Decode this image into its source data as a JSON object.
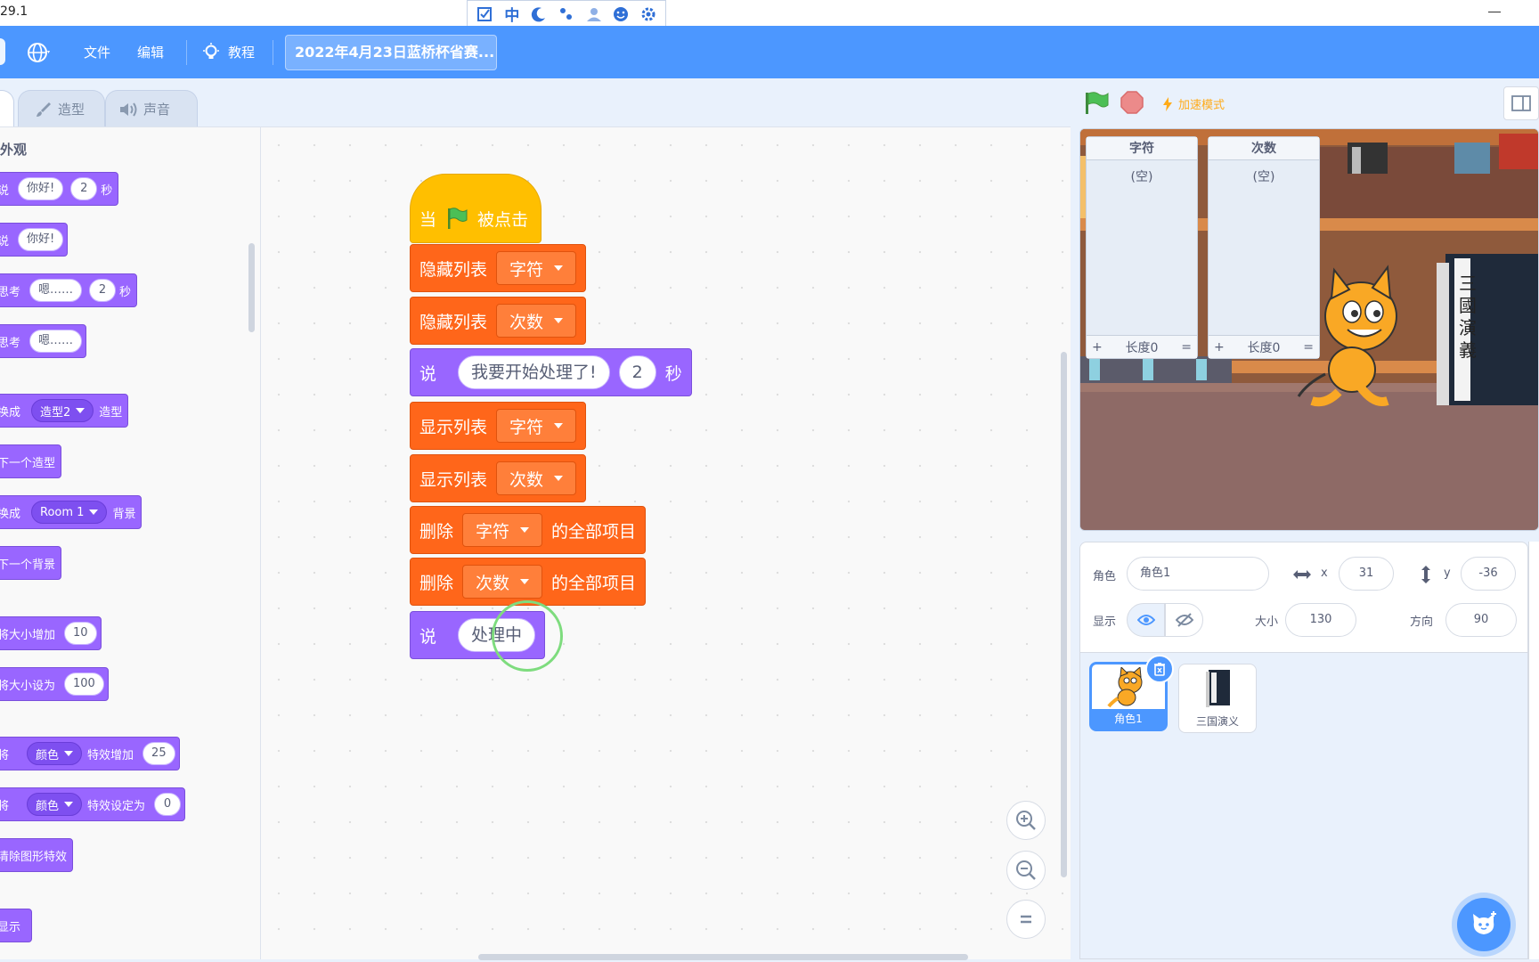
{
  "window": {
    "title": "29.1"
  },
  "ime": {
    "mode_label": "中",
    "icons": [
      "checkbox-icon",
      "chinese-mode-icon",
      "moon-icon",
      "punctuation-icon",
      "user-icon",
      "emoji-icon",
      "gear-icon"
    ]
  },
  "menu": {
    "file": "文件",
    "edit": "编辑",
    "tutorial": "教程",
    "project_title": "2022年4月23日蓝桥杯省赛..."
  },
  "tabs": {
    "costumes": "造型",
    "sounds": "声音"
  },
  "palette": {
    "category": "外观",
    "blocks": {
      "say_secs": {
        "label": "说",
        "text": "你好!",
        "secs": "2",
        "unit": "秒"
      },
      "say": {
        "label": "说",
        "text": "你好!"
      },
      "think_secs": {
        "label": "思考",
        "text": "嗯……",
        "secs": "2",
        "unit": "秒"
      },
      "think": {
        "label": "思考",
        "text": "嗯……"
      },
      "switch_costume": {
        "label": "换成",
        "value": "造型2",
        "suffix": "造型"
      },
      "next_costume": {
        "label": "下一个造型"
      },
      "switch_backdrop": {
        "label": "换成",
        "value": "Room 1",
        "suffix": "背景"
      },
      "next_backdrop": {
        "label": "下一个背景"
      },
      "change_size": {
        "label": "将大小增加",
        "value": "10"
      },
      "set_size": {
        "label": "将大小设为",
        "value": "100"
      },
      "change_effect": {
        "label": "将",
        "effect": "颜色",
        "middle": "特效增加",
        "value": "25"
      },
      "set_effect": {
        "label": "将",
        "effect": "颜色",
        "middle": "特效设定为",
        "value": "0"
      },
      "clear_effects": {
        "label": "清除图形特效"
      },
      "show": {
        "label": "显示"
      }
    }
  },
  "script": {
    "hat": {
      "prefix": "当",
      "suffix": "被点击"
    },
    "hide_list_1": {
      "label": "隐藏列表",
      "list": "字符"
    },
    "hide_list_2": {
      "label": "隐藏列表",
      "list": "次数"
    },
    "say_secs": {
      "label": "说",
      "text": "我要开始处理了!",
      "secs": "2",
      "unit": "秒"
    },
    "show_list_1": {
      "label": "显示列表",
      "list": "字符"
    },
    "show_list_2": {
      "label": "显示列表",
      "list": "次数"
    },
    "delete_all_1": {
      "label": "删除",
      "list": "字符",
      "suffix": "的全部项目"
    },
    "delete_all_2": {
      "label": "删除",
      "list": "次数",
      "suffix": "的全部项目"
    },
    "say_processing": {
      "label": "说",
      "text": "处理中"
    }
  },
  "stage": {
    "turbo": "加速模式",
    "lists": [
      {
        "title": "字符",
        "empty": "(空)",
        "add": "+",
        "length": "长度0",
        "resize": "="
      },
      {
        "title": "次数",
        "empty": "(空)",
        "add": "+",
        "length": "长度0",
        "resize": "="
      }
    ]
  },
  "sprite_info": {
    "sprite_label": "角色",
    "sprite_name": "角色1",
    "x_label": "x",
    "x": "31",
    "y_label": "y",
    "y": "-36",
    "show_label": "显示",
    "size_label": "大小",
    "size": "130",
    "direction_label": "方向",
    "direction": "90"
  },
  "sprites": [
    {
      "name": "角色1",
      "selected": true
    },
    {
      "name": "三国演义",
      "selected": false
    }
  ],
  "colors": {
    "menu_blue": "#4c97ff",
    "looks_purple": "#9966ff",
    "lists_orange": "#ff661a",
    "events_yellow": "#ffbf00"
  }
}
